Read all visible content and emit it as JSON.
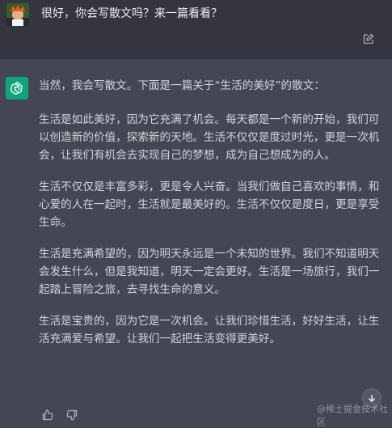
{
  "user_message": {
    "avatar_icon": "user-avatar-icon",
    "text": "很好，你会写散文吗？来一篇看看？",
    "edit_icon": "edit-icon"
  },
  "assistant_message": {
    "avatar_icon": "openai-logo-icon",
    "avatar_color": "#10a37f",
    "intro": "当然，我会写散文。下面是一篇关于“生活的美好”的散文：",
    "paragraphs": [
      "生活是如此美好，因为它充满了机会。每天都是一个新的开始，我们可以创造新的价值，探索新的天地。生活不仅仅是度过时光，更是一次机会，让我们有机会去实现自己的梦想，成为自己想成为的人。",
      "生活不仅仅是丰富多彩，更是令人兴奋。当我们做自己喜欢的事情，和心爱的人在一起时，生活就是最美好的。生活不仅仅是度日，更是享受生命。",
      "生活是充满希望的，因为明天永远是一个未知的世界。我们不知道明天会发生什么，但是我知道，明天一定会更好。生活是一场旅行，我们一起踏上冒险之旅，去寻找生命的意义。",
      "生活是宝贵的，因为它是一次机会。让我们珍惜生活，好好生活，让生活充满爱与希望。让我们一起把生活变得更美好。"
    ],
    "feedback": [
      "thumbs-up-icon",
      "thumbs-down-icon"
    ]
  },
  "scroll_button_icon": "arrow-down-icon",
  "watermark": "@稀土掘金技术社区",
  "colors": {
    "user_bg": "#343541",
    "assistant_bg": "#444654",
    "text": "#d1d5db"
  }
}
